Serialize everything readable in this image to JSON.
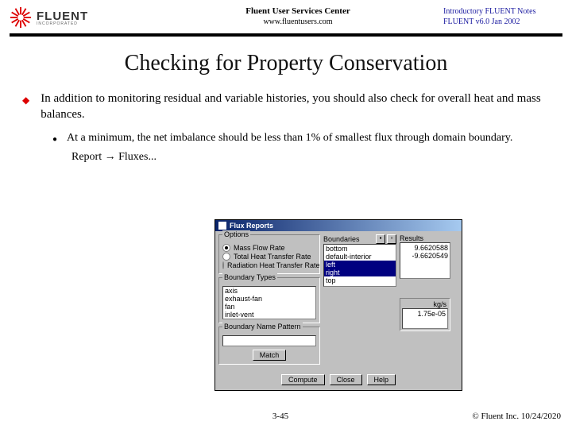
{
  "header": {
    "logo_text": "FLUENT",
    "logo_sub": "INCORPORATED",
    "center_line1": "Fluent User Services Center",
    "center_line2": "www.fluentusers.com",
    "right_line1": "Introductory FLUENT Notes",
    "right_line2": "FLUENT v6.0       Jan 2002"
  },
  "title": "Checking for Property Conservation",
  "bullet1": "In addition to monitoring residual and variable histories, you should also check for overall heat and mass balances.",
  "bullet2": "At a minimum, the net imbalance should be less than 1% of smallest flux through domain boundary.",
  "menu_path": "Report → Fluxes...",
  "dialog": {
    "title": "Flux Reports",
    "options_label": "Options",
    "options": [
      {
        "label": "Mass Flow Rate",
        "selected": true
      },
      {
        "label": "Total Heat Transfer Rate",
        "selected": false
      },
      {
        "label": "Radiation Heat Transfer Rate",
        "selected": false
      }
    ],
    "boundary_types_label": "Boundary Types",
    "boundary_types": [
      "axis",
      "exhaust-fan",
      "fan",
      "inlet-vent"
    ],
    "boundary_name_label": "Boundary Name Pattern",
    "match_btn": "Match",
    "boundaries_label": "Boundaries",
    "boundaries": [
      {
        "label": "bottom",
        "selected": false
      },
      {
        "label": "default-interior",
        "selected": false
      },
      {
        "label": "left",
        "selected": true
      },
      {
        "label": "right",
        "selected": true
      },
      {
        "label": "top",
        "selected": false
      }
    ],
    "results_label": "Results",
    "results": [
      "9.6620588",
      "-9.6620549"
    ],
    "unit": "kg/s",
    "net": "1.75e-05",
    "compute_btn": "Compute",
    "close_btn": "Close",
    "help_btn": "Help"
  },
  "footer": {
    "page": "3-45",
    "copyright": "© Fluent Inc. 10/24/2020"
  }
}
